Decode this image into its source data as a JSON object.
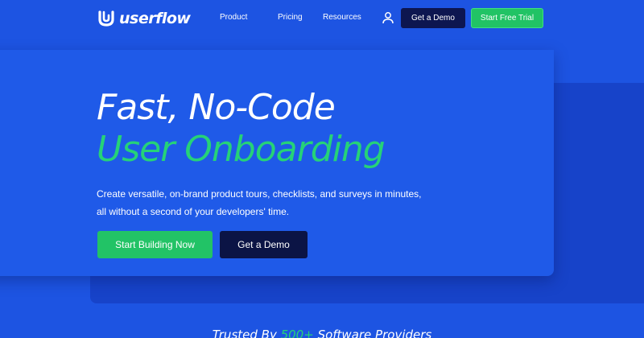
{
  "colors": {
    "background": "#1d54e2",
    "panel_front": "#1f5ae8",
    "panel_back": "#1743c9",
    "accent_green": "#26d278",
    "button_green": "#22c366",
    "button_navy": "#0b1445"
  },
  "nav": {
    "logo_text": "userflow",
    "logo_icon": "userflow-logo-icon",
    "links": [
      "Product",
      "Pricing",
      "Resources"
    ],
    "user_icon": "user-icon",
    "demo_label": "Get a Demo",
    "trial_label": "Start Free Trial"
  },
  "hero": {
    "title_line1": "Fast, No-Code",
    "title_line2": "User Onboarding",
    "subtitle_line1": "Create versatile, on-brand product tours, checklists, and surveys in minutes,",
    "subtitle_line2": "all without a second of your developers' time.",
    "primary_cta": "Start Building Now",
    "secondary_cta": "Get a Demo"
  },
  "trusted": {
    "prefix": "Trusted By ",
    "count": "500+",
    "suffix": " Software Providers"
  }
}
